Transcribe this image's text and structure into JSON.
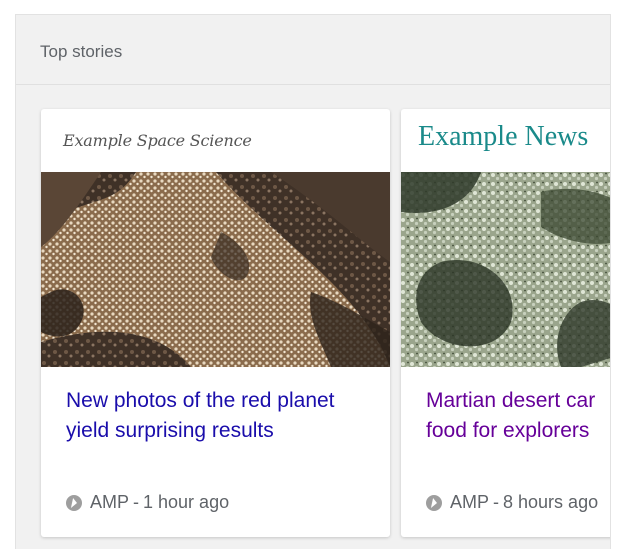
{
  "section": {
    "title": "Top stories"
  },
  "cards": [
    {
      "publisher": "Example Space Science",
      "image": "rock-texture-brown",
      "headline": "New photos of the red planet yield surprising results",
      "amp_label": "AMP",
      "separator": "-",
      "time": "1 hour ago",
      "amp_icon": "amp-bolt-icon"
    },
    {
      "publisher": "Example News",
      "image": "rock-texture-green",
      "headline": "Martian desert car\nfood for explorers",
      "amp_label": "AMP",
      "separator": "-",
      "time": "8 hours ago",
      "amp_icon": "amp-bolt-icon"
    }
  ],
  "colors": {
    "link": "#1a0dab",
    "visited_link": "#660099",
    "publisher_teal": "#1a8a8a",
    "meta_gray": "#5f6368"
  }
}
